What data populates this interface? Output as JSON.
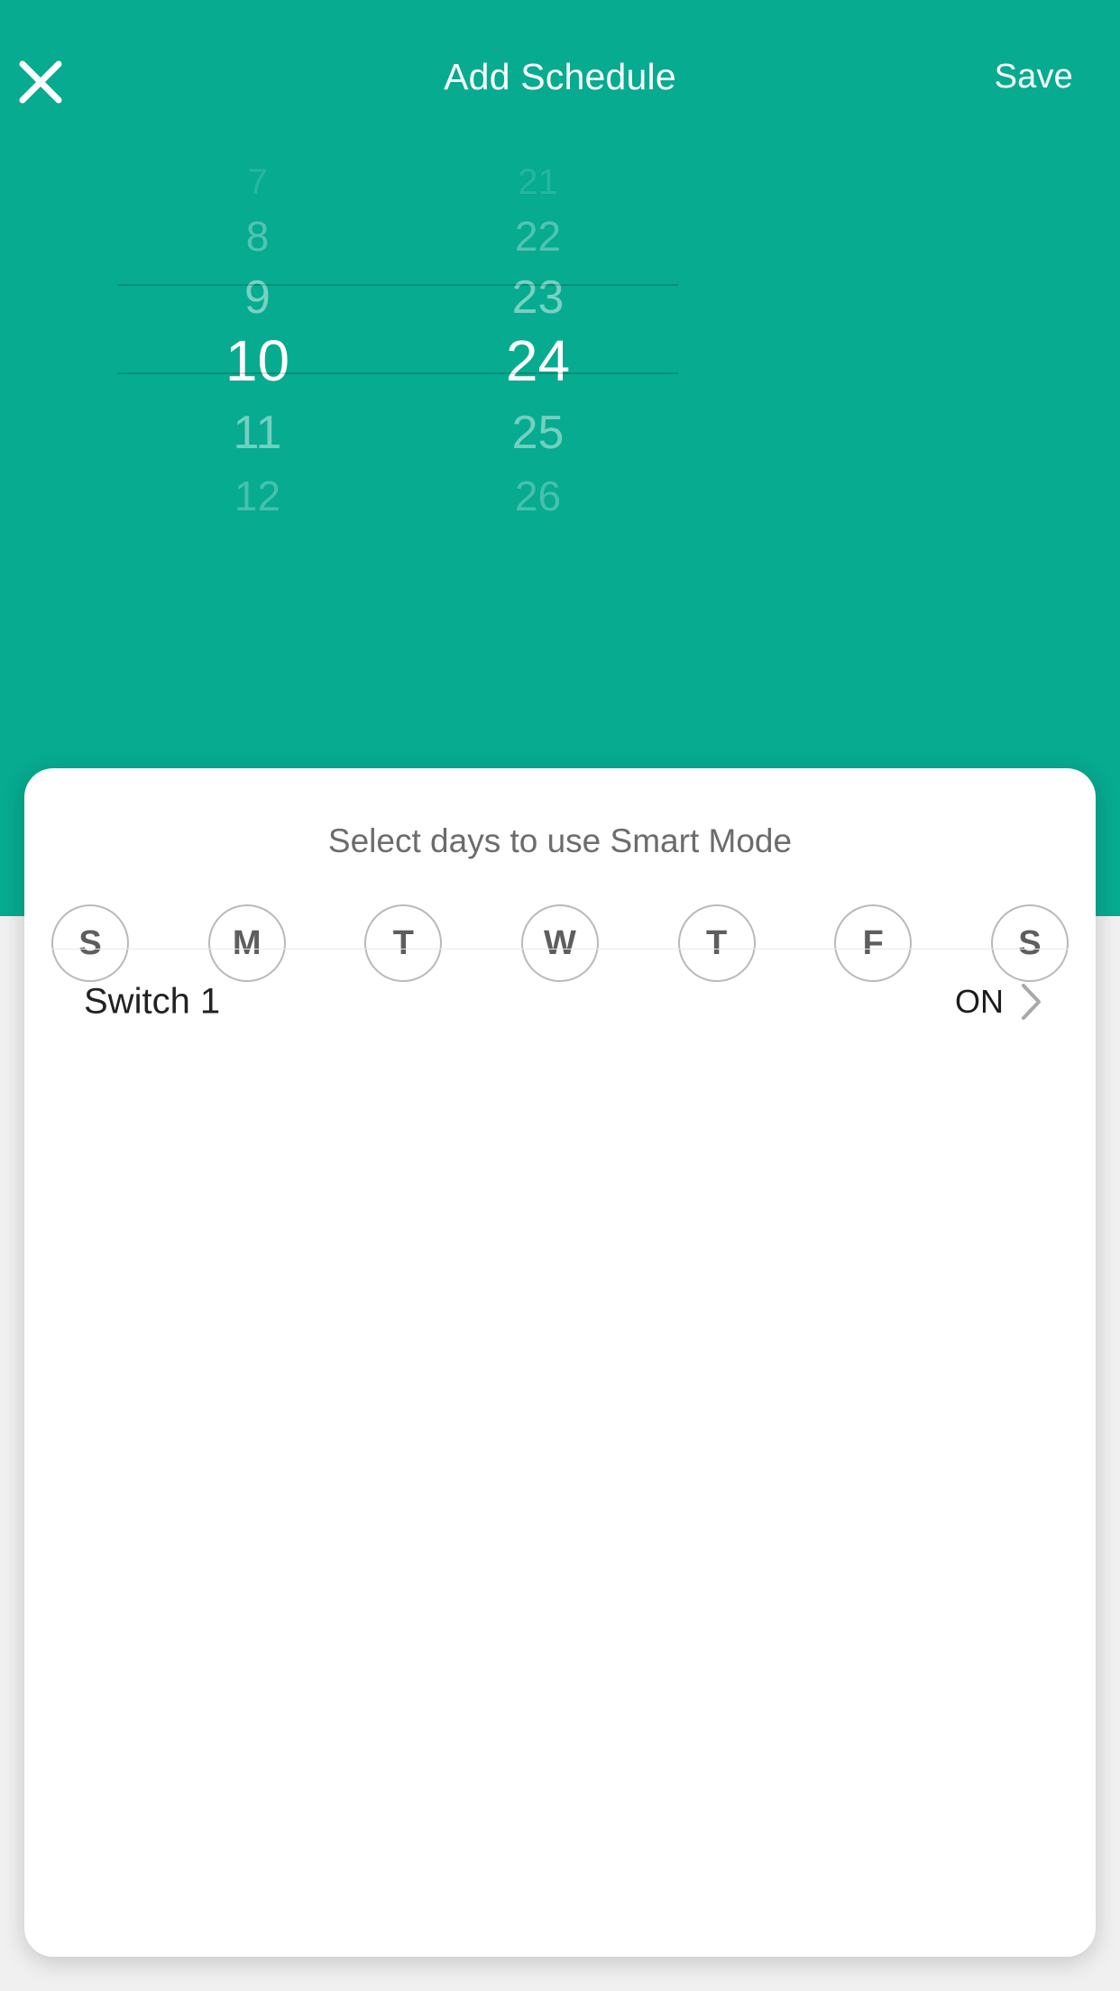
{
  "header": {
    "title": "Add Schedule",
    "close_icon": "close-x-icon",
    "save_label": "Save",
    "background_color": "#06ab90",
    "text_color": "#ffffff"
  },
  "time_picker": {
    "selected_hour": "10",
    "selected_minute": "24",
    "hour_column": [
      "7",
      "8",
      "9",
      "10",
      "11",
      "12"
    ],
    "minute_column": [
      "21",
      "22",
      "23",
      "24",
      "25",
      "26"
    ],
    "selected_index": 3,
    "selection_line_color": "rgba(0,0,0,0.16)"
  },
  "card": {
    "title": "Select days to use Smart Mode",
    "title_color": "#6c6c6c",
    "background_color": "#ffffff",
    "days": [
      {
        "label": "S",
        "name": "sunday",
        "selected": false
      },
      {
        "label": "M",
        "name": "monday",
        "selected": false
      },
      {
        "label": "T",
        "name": "tuesday",
        "selected": false
      },
      {
        "label": "W",
        "name": "wednesday",
        "selected": false
      },
      {
        "label": "T",
        "name": "thursday",
        "selected": false
      },
      {
        "label": "F",
        "name": "friday",
        "selected": false
      },
      {
        "label": "S",
        "name": "saturday",
        "selected": false
      }
    ],
    "action_row": {
      "label": "Switch 1",
      "value": "ON",
      "chevron_icon": "chevron-right-icon"
    }
  },
  "page": {
    "background_color": "#f0f0f0",
    "accent_color": "#06ab90"
  }
}
